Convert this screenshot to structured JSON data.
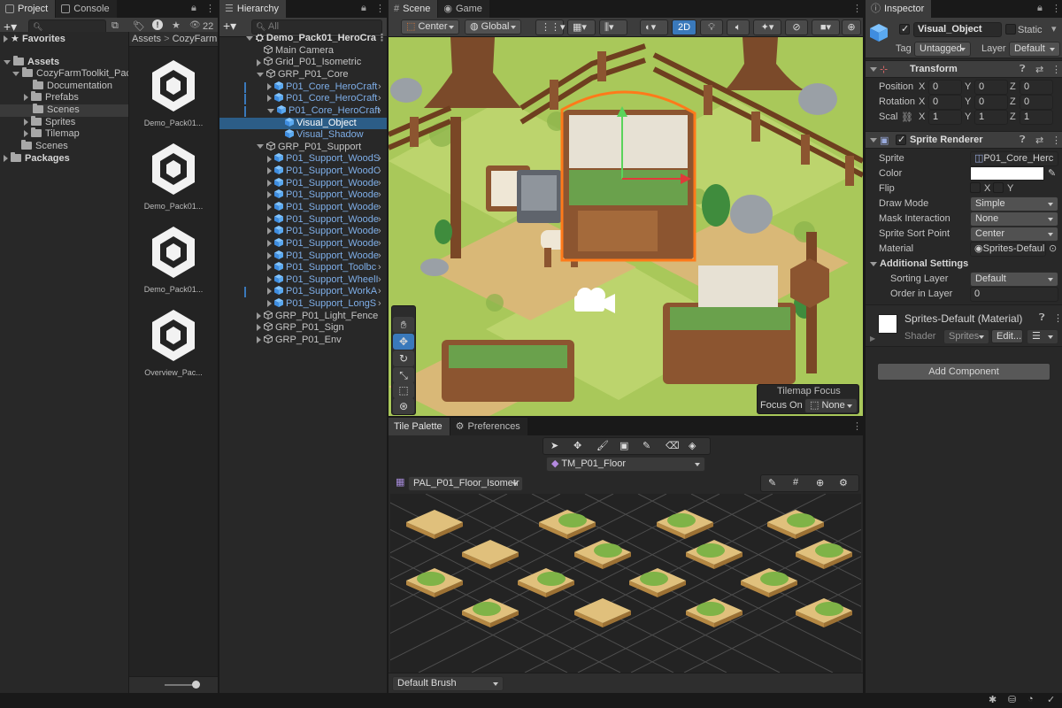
{
  "project_panel": {
    "tabs": [
      {
        "label": "Project",
        "active": true
      },
      {
        "label": "Console",
        "active": false
      }
    ],
    "add_label": "+▾",
    "asset_count": "22",
    "tree": [
      {
        "label": "Favorites",
        "level": 0,
        "kind": "star",
        "bold": true
      },
      {
        "label": "Assets",
        "level": 0,
        "kind": "folder",
        "bold": true
      },
      {
        "label": "CozyFarmToolkit_Pac",
        "level": 1,
        "kind": "folder"
      },
      {
        "label": "Documentation",
        "level": 2,
        "kind": "folder"
      },
      {
        "label": "Prefabs",
        "level": 2,
        "kind": "folder"
      },
      {
        "label": "Scenes",
        "level": 2,
        "kind": "folder",
        "selected": true
      },
      {
        "label": "Sprites",
        "level": 2,
        "kind": "folder"
      },
      {
        "label": "Tilemap",
        "level": 2,
        "kind": "folder"
      },
      {
        "label": "Scenes",
        "level": 1,
        "kind": "folder"
      },
      {
        "label": "Packages",
        "level": 0,
        "kind": "folder",
        "bold": true
      }
    ],
    "breadcrumb": [
      "Assets",
      "CozyFarm"
    ],
    "assets": [
      "Demo_Pack01...",
      "Demo_Pack01...",
      "Demo_Pack01...",
      "Overview_Pac..."
    ]
  },
  "hierarchy": {
    "tab": "Hierarchy",
    "search_placeholder": "All",
    "root": "Demo_Pack01_HeroCra",
    "items": [
      {
        "label": "Main Camera",
        "level": 1,
        "kind": "go"
      },
      {
        "label": "Grid_P01_Isometric",
        "level": 1,
        "kind": "go",
        "arrow": "closed"
      },
      {
        "label": "GRP_P01_Core",
        "level": 1,
        "kind": "go",
        "arrow": "open"
      },
      {
        "label": "P01_Core_HeroCraft",
        "level": 2,
        "kind": "prefab",
        "arrow": "closed",
        "more": true
      },
      {
        "label": "P01_Core_HeroCraft",
        "level": 2,
        "kind": "prefab",
        "arrow": "closed",
        "more": true
      },
      {
        "label": "P01_Core_HeroCraft",
        "level": 2,
        "kind": "prefab",
        "arrow": "open",
        "more": true
      },
      {
        "label": "Visual_Object",
        "level": 3,
        "kind": "prefab-child",
        "selected": true
      },
      {
        "label": "Visual_Shadow",
        "level": 3,
        "kind": "prefab-child"
      },
      {
        "label": "GRP_P01_Support",
        "level": 1,
        "kind": "go",
        "arrow": "open"
      },
      {
        "label": "P01_Support_WoodS",
        "level": 2,
        "kind": "prefab",
        "arrow": "closed",
        "more": true
      },
      {
        "label": "P01_Support_WoodC",
        "level": 2,
        "kind": "prefab",
        "arrow": "closed",
        "more": true
      },
      {
        "label": "P01_Support_Woode",
        "level": 2,
        "kind": "prefab",
        "arrow": "closed",
        "more": true
      },
      {
        "label": "P01_Support_Woode",
        "level": 2,
        "kind": "prefab",
        "arrow": "closed",
        "more": true
      },
      {
        "label": "P01_Support_Woode",
        "level": 2,
        "kind": "prefab",
        "arrow": "closed",
        "more": true
      },
      {
        "label": "P01_Support_Woode",
        "level": 2,
        "kind": "prefab",
        "arrow": "closed",
        "more": true
      },
      {
        "label": "P01_Support_Woode",
        "level": 2,
        "kind": "prefab",
        "arrow": "closed",
        "more": true
      },
      {
        "label": "P01_Support_Woode",
        "level": 2,
        "kind": "prefab",
        "arrow": "closed",
        "more": true
      },
      {
        "label": "P01_Support_Woode",
        "level": 2,
        "kind": "prefab",
        "arrow": "closed",
        "more": true
      },
      {
        "label": "P01_Support_Toolbc",
        "level": 2,
        "kind": "prefab",
        "arrow": "closed",
        "more": true
      },
      {
        "label": "P01_Support_WheelI",
        "level": 2,
        "kind": "prefab",
        "arrow": "closed",
        "more": true
      },
      {
        "label": "P01_Support_WorkA",
        "level": 2,
        "kind": "prefab",
        "arrow": "closed",
        "more": true
      },
      {
        "label": "P01_Support_LongS",
        "level": 2,
        "kind": "prefab",
        "arrow": "closed",
        "more": true
      },
      {
        "label": "GRP_P01_Light_Fence",
        "level": 1,
        "kind": "go",
        "arrow": "closed"
      },
      {
        "label": "GRP_P01_Sign",
        "level": 1,
        "kind": "go",
        "arrow": "closed"
      },
      {
        "label": "GRP_P01_Env",
        "level": 1,
        "kind": "go",
        "arrow": "closed"
      }
    ]
  },
  "scene": {
    "tabs": [
      {
        "label": "Scene",
        "active": true
      },
      {
        "label": "Game",
        "active": false
      }
    ],
    "pivot": "Center",
    "space": "Global",
    "mode_2d": "2D",
    "tilemap_focus": {
      "title": "Tilemap Focus",
      "label": "Focus On",
      "value": "None"
    }
  },
  "tile_palette": {
    "tabs": [
      {
        "label": "Tile Palette",
        "active": true
      },
      {
        "label": "Preferences",
        "active": false
      }
    ],
    "tilemap": "TM_P01_Floor",
    "palette": "PAL_P01_Floor_Isometr",
    "brush": "Default Brush"
  },
  "inspector": {
    "tab": "Inspector",
    "object_name": "Visual_Object",
    "static_label": "Static",
    "tag_label": "Tag",
    "tag_value": "Untagged",
    "layer_label": "Layer",
    "layer_value": "Default",
    "transform": {
      "title": "Transform",
      "rows": [
        {
          "label": "Position",
          "x": "0",
          "y": "0",
          "z": "0"
        },
        {
          "label": "Rotation",
          "x": "0",
          "y": "0",
          "z": "0"
        },
        {
          "label": "Scal",
          "x": "1",
          "y": "1",
          "z": "1"
        }
      ]
    },
    "sprite_renderer": {
      "title": "Sprite Renderer",
      "sprite_label": "Sprite",
      "sprite_value": "P01_Core_Herc",
      "color_label": "Color",
      "flip_label": "Flip",
      "flip_x": "X",
      "flip_y": "Y",
      "draw_mode_label": "Draw Mode",
      "draw_mode": "Simple",
      "mask_label": "Mask Interaction",
      "mask_value": "None",
      "sort_point_label": "Sprite Sort Point",
      "sort_point": "Center",
      "material_label": "Material",
      "material_value": "Sprites-Defaul",
      "additional_title": "Additional Settings",
      "sorting_layer_label": "Sorting Layer",
      "sorting_layer": "Default",
      "order_label": "Order in Layer",
      "order_value": "0"
    },
    "material": {
      "title": "Sprites-Default (Material)",
      "shader_label": "Shader",
      "shader_value": "Sprites",
      "edit_label": "Edit..."
    },
    "add_component": "Add Component"
  },
  "colors": {
    "selection": "#2c5d87",
    "prefab_text": "#7eaee8",
    "accent": "#3a79bb"
  }
}
